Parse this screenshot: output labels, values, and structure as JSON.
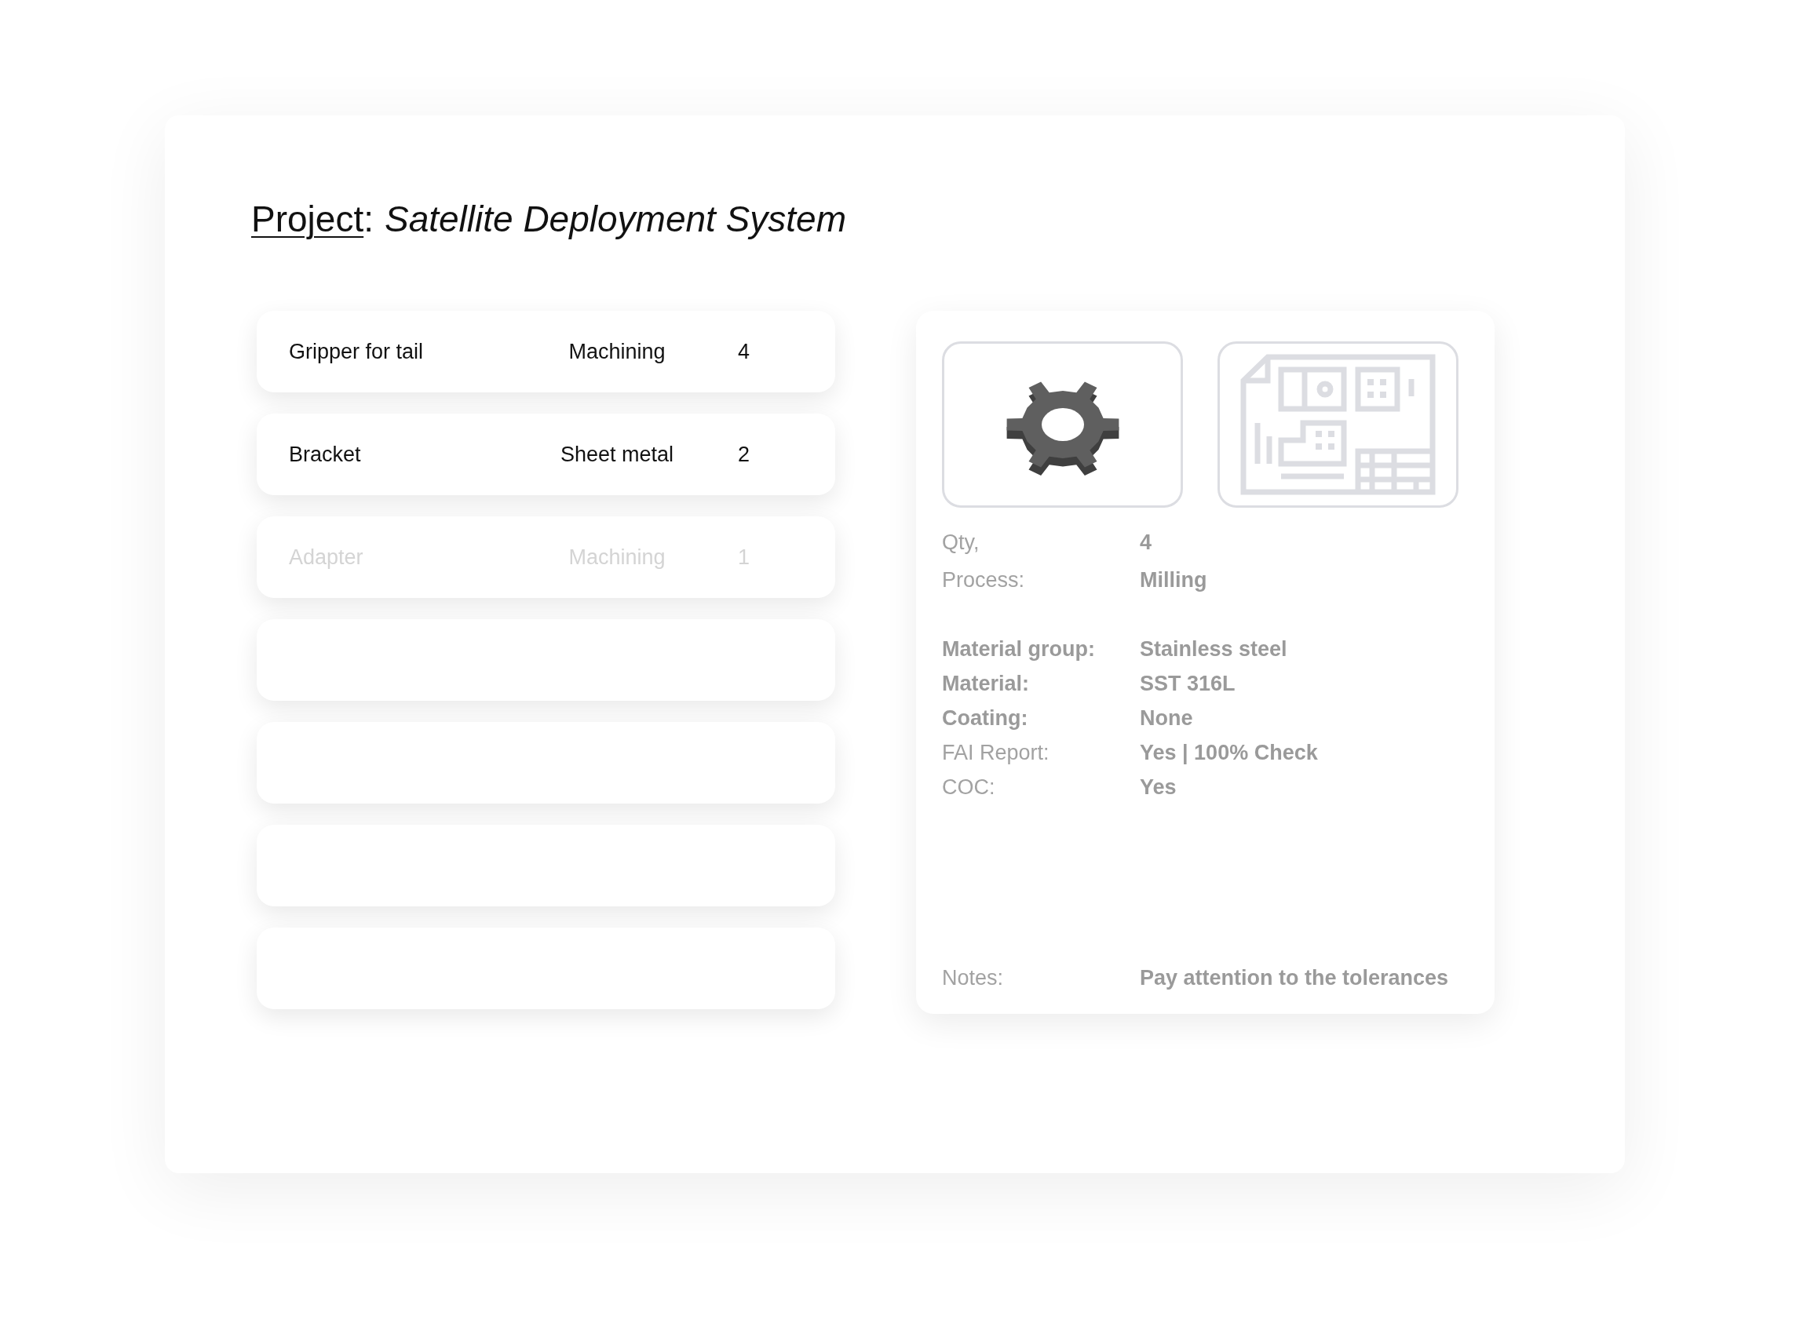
{
  "title": {
    "label": "Project",
    "separator": ":",
    "name": "Satellite Deployment System"
  },
  "parts": [
    {
      "kind": "part",
      "name": "Gripper for tail",
      "process": "Machining",
      "qty": "4",
      "disabled": false
    },
    {
      "kind": "part",
      "name": "Bracket",
      "process": "Sheet metal",
      "qty": "2",
      "disabled": false
    },
    {
      "kind": "part",
      "name": "Adapter",
      "process": "Machining",
      "qty": "1",
      "disabled": true
    },
    {
      "kind": "empty"
    },
    {
      "kind": "empty"
    },
    {
      "kind": "empty"
    },
    {
      "kind": "empty"
    }
  ],
  "details": {
    "sections": [
      {
        "fields": [
          {
            "label": "Qty,",
            "value": "4",
            "strong_label": false
          },
          {
            "label": "Process:",
            "value": "Milling",
            "strong_label": false
          }
        ]
      },
      {
        "fields": [
          {
            "label": "Material group:",
            "value": "Stainless steel",
            "strong_label": true
          },
          {
            "label": "Material:",
            "value": "SST 316L",
            "strong_label": true
          },
          {
            "label": "Coating:",
            "value": "None",
            "strong_label": true
          },
          {
            "label": "FAI Report:",
            "value": "Yes | 100% Check",
            "strong_label": false
          },
          {
            "label": "COC:",
            "value": "Yes",
            "strong_label": false
          }
        ]
      },
      {
        "fields": [
          {
            "label": "Notes:",
            "value": "Pay attention to the tolerances",
            "strong_label": false
          }
        ]
      }
    ]
  }
}
